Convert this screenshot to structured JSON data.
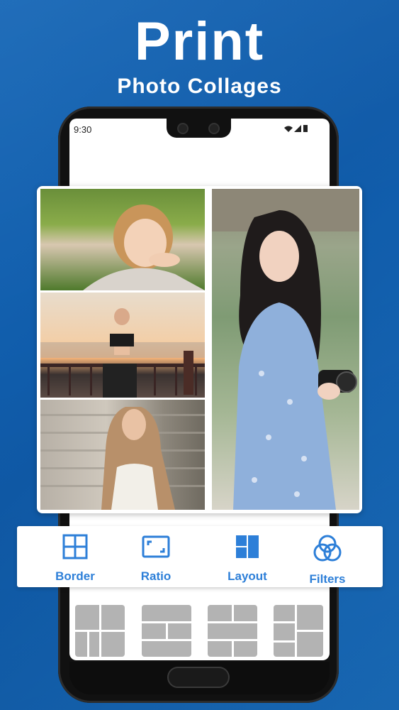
{
  "headline": {
    "title": "Print",
    "subtitle": "Photo Collages"
  },
  "status_bar": {
    "time": "9:30"
  },
  "toolbar": {
    "items": [
      {
        "label": "Border",
        "icon": "grid-icon"
      },
      {
        "label": "Ratio",
        "icon": "aspect-ratio-icon"
      },
      {
        "label": "Layout",
        "icon": "layout-icon"
      },
      {
        "label": "Filters",
        "icon": "filters-icon"
      }
    ]
  },
  "colors": {
    "background": "#1565b5",
    "accent": "#2d7fd8",
    "thumb": "#b3b3b3"
  }
}
